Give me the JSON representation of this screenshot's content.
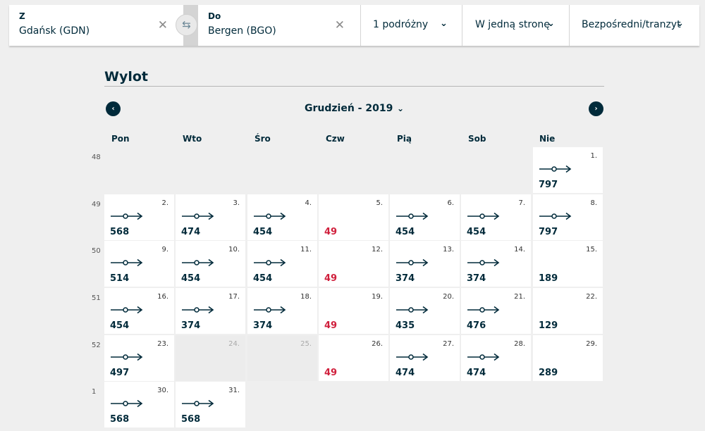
{
  "search": {
    "from_label": "Z",
    "from_value": "Gdańsk (GDN)",
    "to_label": "Do",
    "to_value": "Bergen (BGO)",
    "clear_glyph": "✕",
    "swap_glyph": "⇆",
    "passengers": "1 podróżny",
    "trip_type": "W jedną stronę",
    "connection": "Bezpośredni/tranzyt",
    "chevron": "⌄"
  },
  "calendar": {
    "title": "Wylot",
    "month": "Grudzień - 2019",
    "month_chevron": "⌄",
    "prev_glyph": "‹",
    "next_glyph": "›",
    "weekdays": [
      "Pon",
      "Wto",
      "Śro",
      "Czw",
      "Pią",
      "Sob",
      "Nie"
    ],
    "weeks": [
      "48",
      "49",
      "50",
      "51",
      "52",
      "1"
    ],
    "days": [
      {
        "day": "1.",
        "price": "797",
        "flight": true,
        "red": false
      },
      {
        "day": "2.",
        "price": "568",
        "flight": true,
        "red": false
      },
      {
        "day": "3.",
        "price": "474",
        "flight": true,
        "red": false
      },
      {
        "day": "4.",
        "price": "454",
        "flight": true,
        "red": false
      },
      {
        "day": "5.",
        "price": "49",
        "flight": false,
        "red": true
      },
      {
        "day": "6.",
        "price": "454",
        "flight": true,
        "red": false
      },
      {
        "day": "7.",
        "price": "454",
        "flight": true,
        "red": false
      },
      {
        "day": "8.",
        "price": "797",
        "flight": true,
        "red": false
      },
      {
        "day": "9.",
        "price": "514",
        "flight": true,
        "red": false
      },
      {
        "day": "10.",
        "price": "454",
        "flight": true,
        "red": false
      },
      {
        "day": "11.",
        "price": "454",
        "flight": true,
        "red": false
      },
      {
        "day": "12.",
        "price": "49",
        "flight": false,
        "red": true
      },
      {
        "day": "13.",
        "price": "374",
        "flight": true,
        "red": false
      },
      {
        "day": "14.",
        "price": "374",
        "flight": true,
        "red": false
      },
      {
        "day": "15.",
        "price": "189",
        "flight": false,
        "red": false
      },
      {
        "day": "16.",
        "price": "454",
        "flight": true,
        "red": false
      },
      {
        "day": "17.",
        "price": "374",
        "flight": true,
        "red": false
      },
      {
        "day": "18.",
        "price": "374",
        "flight": true,
        "red": false
      },
      {
        "day": "19.",
        "price": "49",
        "flight": false,
        "red": true
      },
      {
        "day": "20.",
        "price": "435",
        "flight": true,
        "red": false
      },
      {
        "day": "21.",
        "price": "476",
        "flight": true,
        "red": false
      },
      {
        "day": "22.",
        "price": "129",
        "flight": false,
        "red": false
      },
      {
        "day": "23.",
        "price": "497",
        "flight": true,
        "red": false
      },
      {
        "day": "24.",
        "price": "",
        "flight": false,
        "red": false,
        "disabled": true
      },
      {
        "day": "25.",
        "price": "",
        "flight": false,
        "red": false,
        "disabled": true
      },
      {
        "day": "26.",
        "price": "49",
        "flight": false,
        "red": true
      },
      {
        "day": "27.",
        "price": "474",
        "flight": true,
        "red": false
      },
      {
        "day": "28.",
        "price": "474",
        "flight": true,
        "red": false
      },
      {
        "day": "29.",
        "price": "289",
        "flight": false,
        "red": false
      },
      {
        "day": "30.",
        "price": "568",
        "flight": true,
        "red": false
      },
      {
        "day": "31.",
        "price": "568",
        "flight": true,
        "red": false
      }
    ]
  },
  "colors": {
    "navy": "#002a3a",
    "low_price_red": "#d01f3c",
    "background": "#efefef"
  },
  "icons": {
    "flight_route": "direct-flight-icon"
  }
}
